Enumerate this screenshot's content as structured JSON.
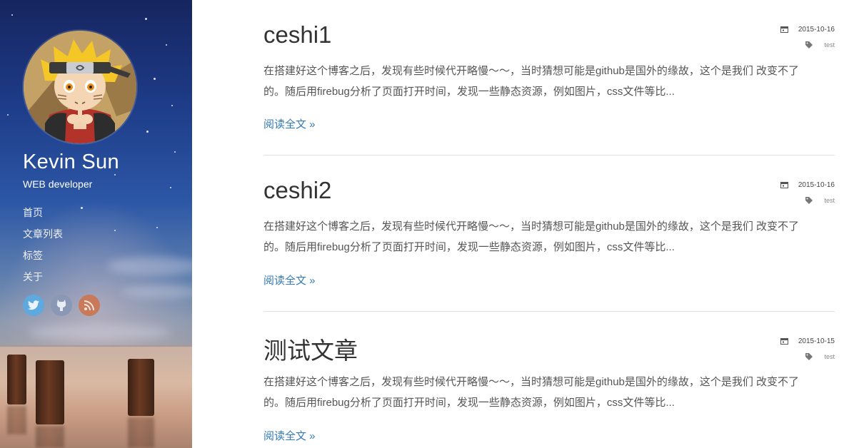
{
  "author": {
    "name": "Kevin Sun",
    "title": "WEB developer"
  },
  "nav": {
    "items": [
      "首页",
      "文章列表",
      "标签",
      "关于"
    ]
  },
  "social": {
    "items": [
      {
        "name": "twitter",
        "icon": "twitter-icon",
        "color": "#5ea9dd"
      },
      {
        "name": "github",
        "icon": "github-icon",
        "color": "#8a97b5"
      },
      {
        "name": "rss",
        "icon": "rss-icon",
        "color": "#c87a5b"
      }
    ]
  },
  "posts": [
    {
      "title": "ceshi1",
      "date": "2015-10-16",
      "tag": "test",
      "excerpt_line1": "在搭建好这个博客之后，发现有些时候代开略慢～～，当时猜想可能是github是国外的缘故，这个是我们 改变不了",
      "excerpt_line2": "的。随后用firebug分析了页面打开时间，发现一些静态资源，例如图片，css文件等比...",
      "read_more": "阅读全文 »"
    },
    {
      "title": "ceshi2",
      "date": "2015-10-16",
      "tag": "test",
      "excerpt_line1": "在搭建好这个博客之后，发现有些时候代开略慢～～，当时猜想可能是github是国外的缘故，这个是我们 改变不了",
      "excerpt_line2": "的。随后用firebug分析了页面打开时间，发现一些静态资源，例如图片，css文件等比...",
      "read_more": "阅读全文 »"
    },
    {
      "title": "测试文章",
      "date": "2015-10-15",
      "tag": "test",
      "excerpt_line1": "在搭建好这个博客之后，发现有些时候代开略慢～～，当时猜想可能是github是国外的缘故，这个是我们 改变不了",
      "excerpt_line2": "的。随后用firebug分析了页面打开时间，发现一些静态资源，例如图片，css文件等比...",
      "read_more": "阅读全文 »"
    }
  ],
  "colors": {
    "link": "#337ab7",
    "text": "#333333",
    "divider": "#e1e1e1"
  }
}
